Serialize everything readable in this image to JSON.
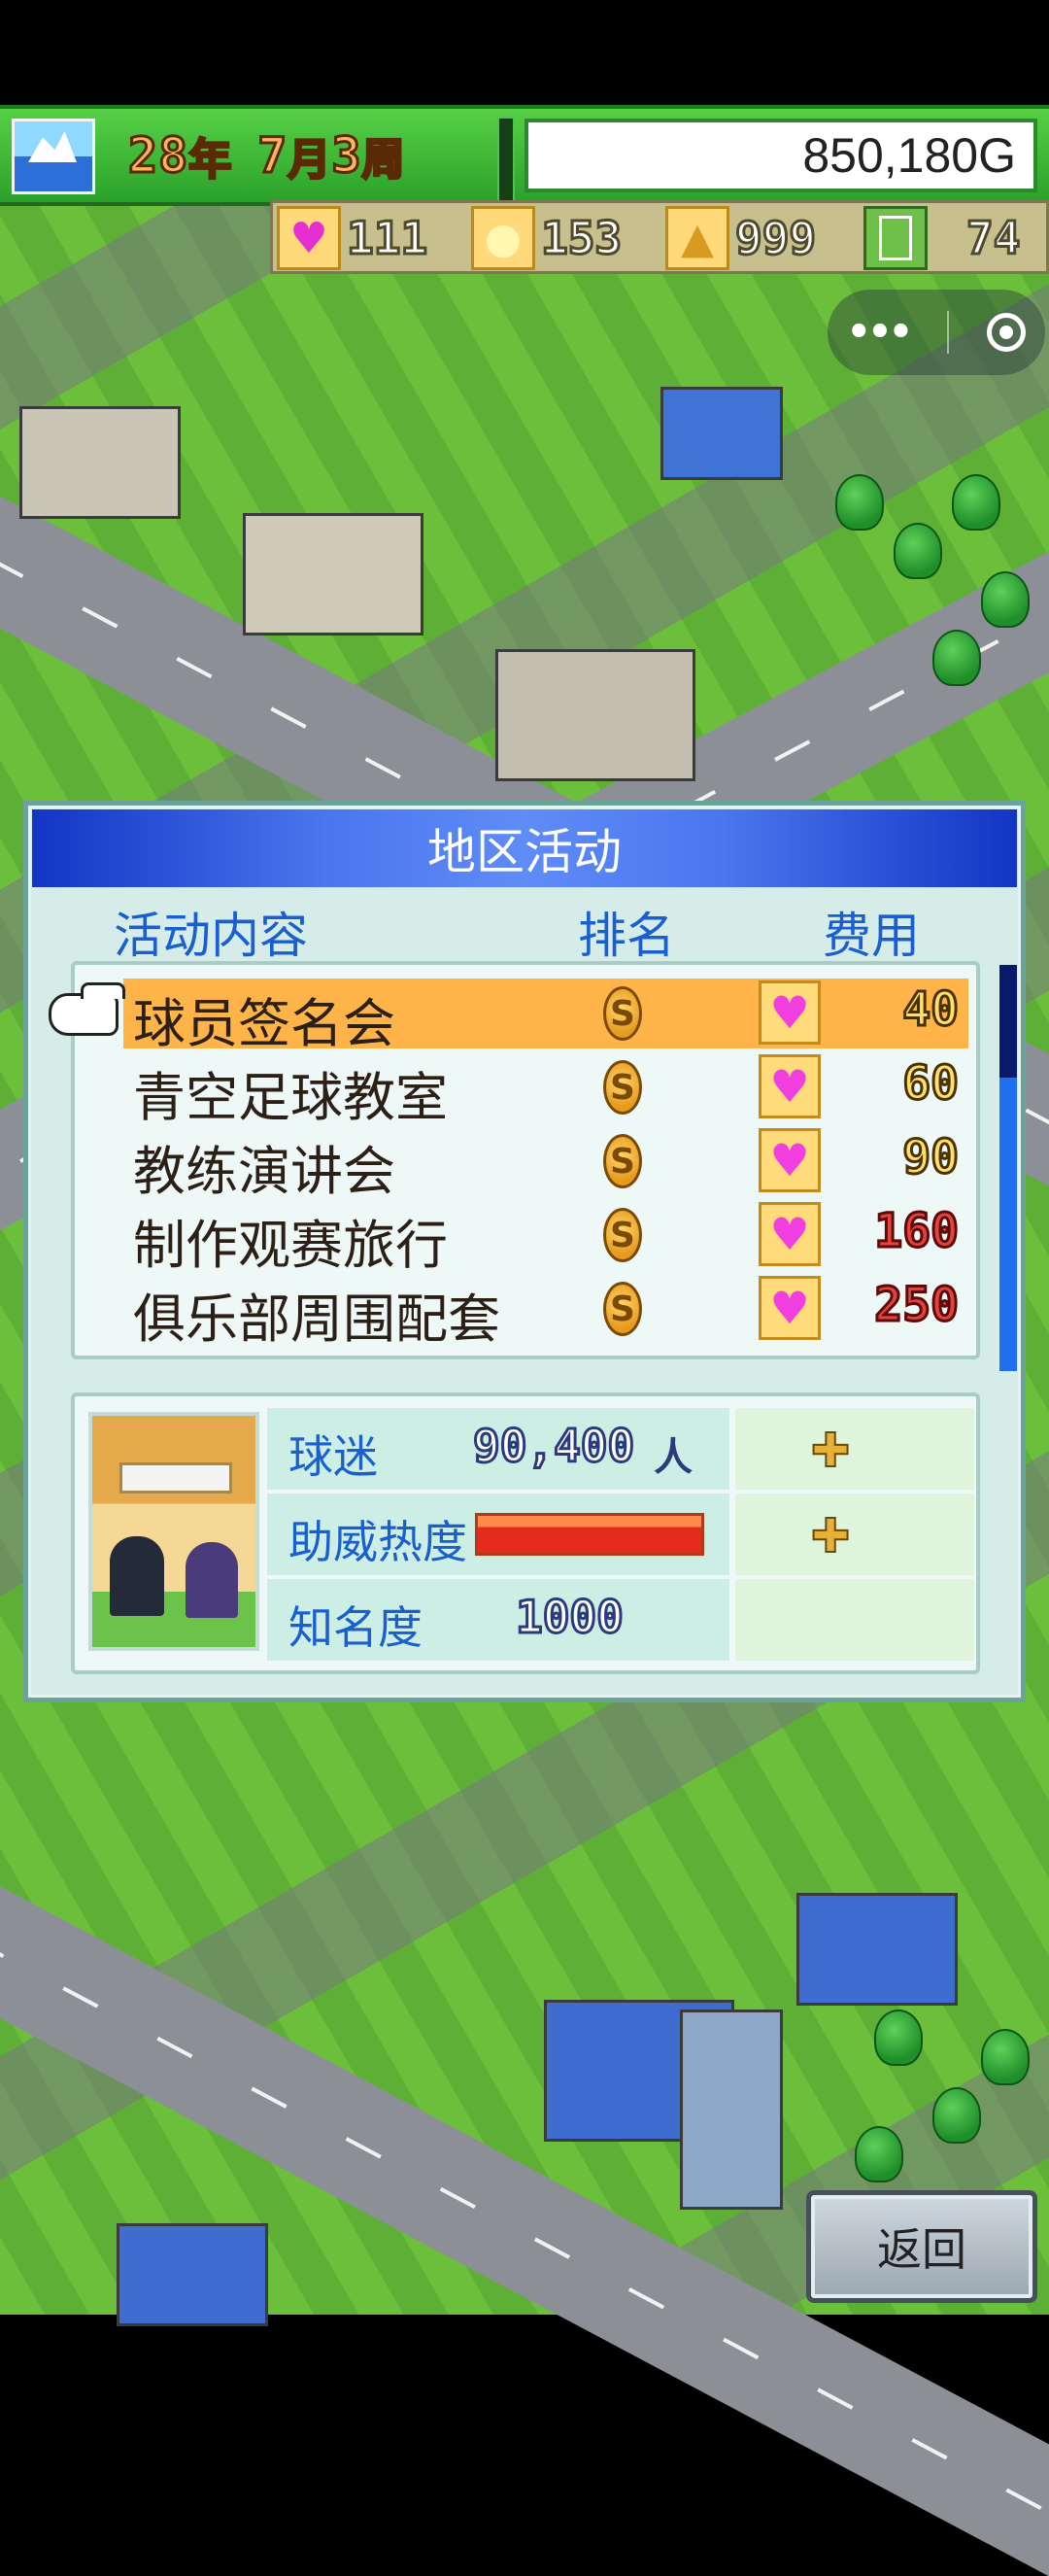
{
  "status_bar": {
    "year": "28",
    "year_unit": "年",
    "month": "7",
    "month_unit": "月",
    "week": "3",
    "week_unit": "周",
    "money": "850,180G"
  },
  "resources": {
    "hearts": "111",
    "ideas": "153",
    "fans": "999",
    "field": "74"
  },
  "dialog": {
    "title": "地区活动",
    "col_content": "活动内容",
    "col_rank": "排名",
    "col_cost": "费用",
    "rows": [
      {
        "name": "球员签名会",
        "rank": "S",
        "cost": "40",
        "cost_color": "yellow",
        "selected": true
      },
      {
        "name": "青空足球教室",
        "rank": "S",
        "cost": "60",
        "cost_color": "yellow",
        "selected": false
      },
      {
        "name": "教练演讲会",
        "rank": "S",
        "cost": "90",
        "cost_color": "yellow",
        "selected": false
      },
      {
        "name": "制作观赛旅行",
        "rank": "S",
        "cost": "160",
        "cost_color": "red",
        "selected": false
      },
      {
        "name": "俱乐部周围配套",
        "rank": "S",
        "cost": "250",
        "cost_color": "red",
        "selected": false
      }
    ],
    "stats": {
      "fans_label": "球迷",
      "fans_value": "90,400",
      "fans_unit": "人",
      "support_label": "助威热度",
      "support_level": 1.0,
      "fame_label": "知名度",
      "fame_value": "1000"
    }
  },
  "back_button": "返回",
  "colors": {
    "header_blue": "#1235c4",
    "selected_row": "#ffb44a",
    "label_blue": "#1a5fd0",
    "topbar_green": "#2aa12a"
  }
}
